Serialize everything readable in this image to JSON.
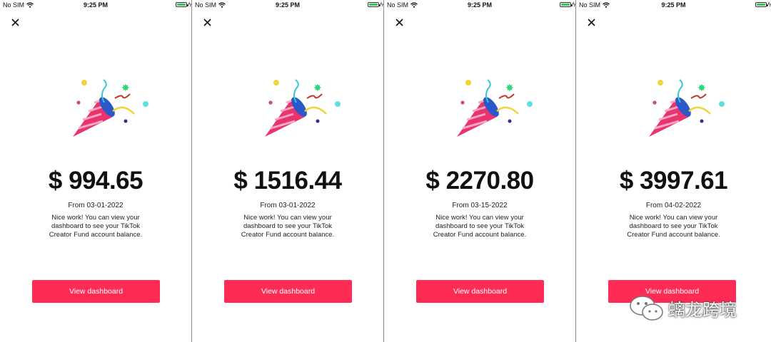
{
  "status_bar": {
    "carrier": "No SIM",
    "time": "9:25 PM"
  },
  "screens": [
    {
      "amount": "$ 994.65",
      "from": "From 03-01-2022",
      "message": "Nice work! You can view your dashboard to see your TikTok Creator Fund account balance.",
      "button": "View dashboard"
    },
    {
      "amount": "$ 1516.44",
      "from": "From 03-01-2022",
      "message": "Nice work! You can view your dashboard to see your TikTok Creator Fund account balance.",
      "button": "View dashboard"
    },
    {
      "amount": "$ 2270.80",
      "from": "From 03-15-2022",
      "message": "Nice work! You can view your dashboard to see your TikTok Creator Fund account balance.",
      "button": "View dashboard"
    },
    {
      "amount": "$ 3997.61",
      "from": "From 04-02-2022",
      "message": "Nice work! You can view your dashboard to see your TikTok Creator Fund account balance.",
      "button": "View dashboard"
    }
  ],
  "watermark": {
    "text": "螭龙跨境",
    "icon": "wechat-icon"
  },
  "colors": {
    "accent": "#fe2c55"
  }
}
